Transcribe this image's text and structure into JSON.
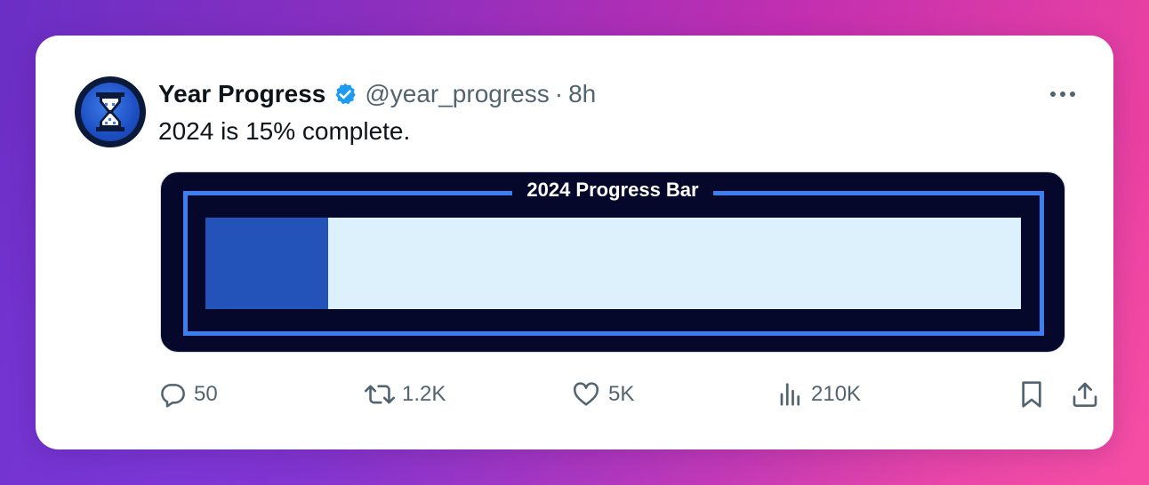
{
  "tweet": {
    "author_name": "Year Progress",
    "handle": "@year_progress",
    "separator": "·",
    "time": "8h",
    "text": "2024 is 15% complete."
  },
  "media": {
    "title": "2024 Progress Bar",
    "progress_fraction": 0.15,
    "colors": {
      "background": "#05082b",
      "frame": "#3d7ff0",
      "fill": "#2352b8",
      "track": "#ddf1fc"
    }
  },
  "actions": {
    "replies": "50",
    "reposts": "1.2K",
    "likes": "5K",
    "views": "210K"
  },
  "icons": [
    "hourglass-icon",
    "verified-badge-icon",
    "more-icon",
    "reply-icon",
    "repost-icon",
    "like-icon",
    "views-icon",
    "bookmark-icon",
    "share-icon"
  ]
}
